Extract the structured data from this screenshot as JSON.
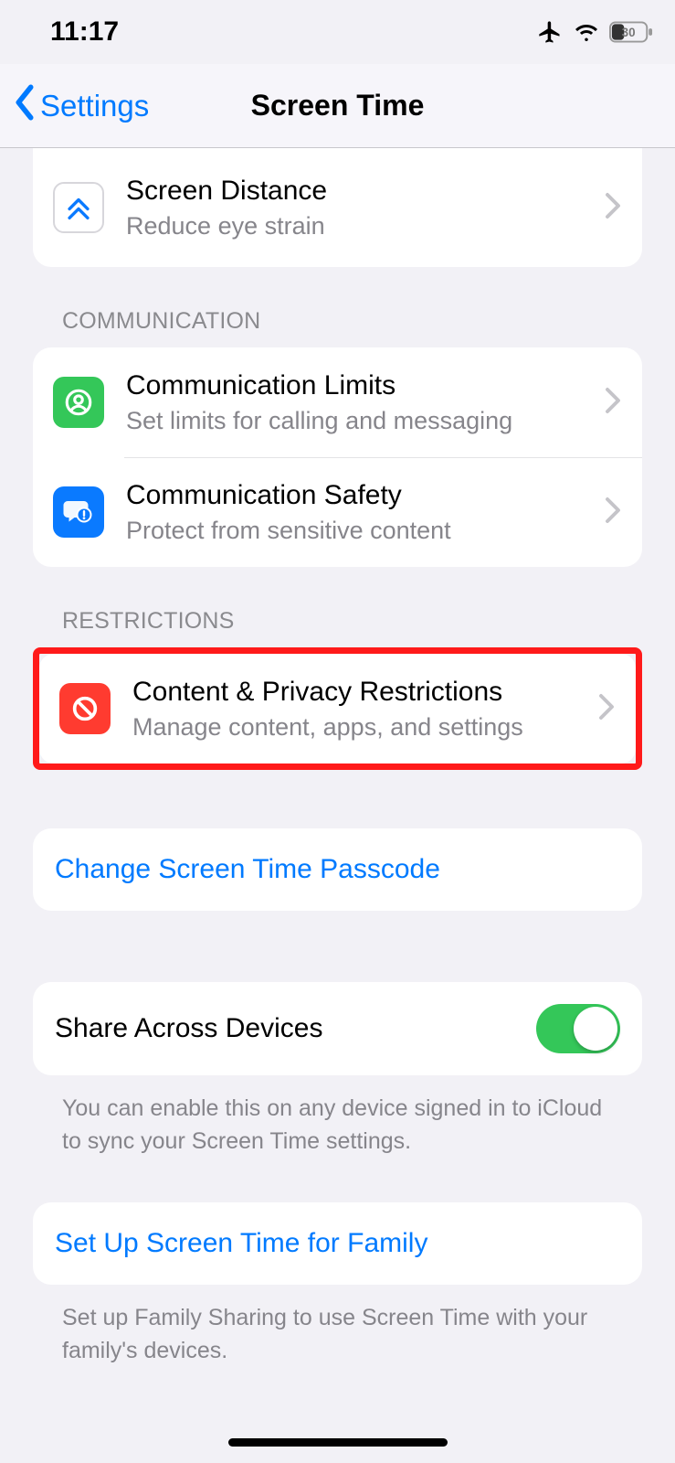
{
  "status_bar": {
    "time": "11:17",
    "battery_percent": "30"
  },
  "nav": {
    "back_label": "Settings",
    "title": "Screen Time"
  },
  "partial_top": {
    "title": "Screen Distance",
    "subtitle": "Reduce eye strain"
  },
  "sections": {
    "communication": {
      "header": "COMMUNICATION",
      "items": [
        {
          "title": "Communication Limits",
          "subtitle": "Set limits for calling and messaging"
        },
        {
          "title": "Communication Safety",
          "subtitle": "Protect from sensitive content"
        }
      ]
    },
    "restrictions": {
      "header": "RESTRICTIONS",
      "items": [
        {
          "title": "Content & Privacy Restrictions",
          "subtitle": "Manage content, apps, and settings"
        }
      ]
    },
    "passcode": {
      "label": "Change Screen Time Passcode"
    },
    "share": {
      "label": "Share Across Devices",
      "enabled": true,
      "footer": "You can enable this on any device signed in to iCloud to sync your Screen Time settings."
    },
    "family": {
      "label": "Set Up Screen Time for Family",
      "footer": "Set up Family Sharing to use Screen Time with your family's devices."
    }
  }
}
